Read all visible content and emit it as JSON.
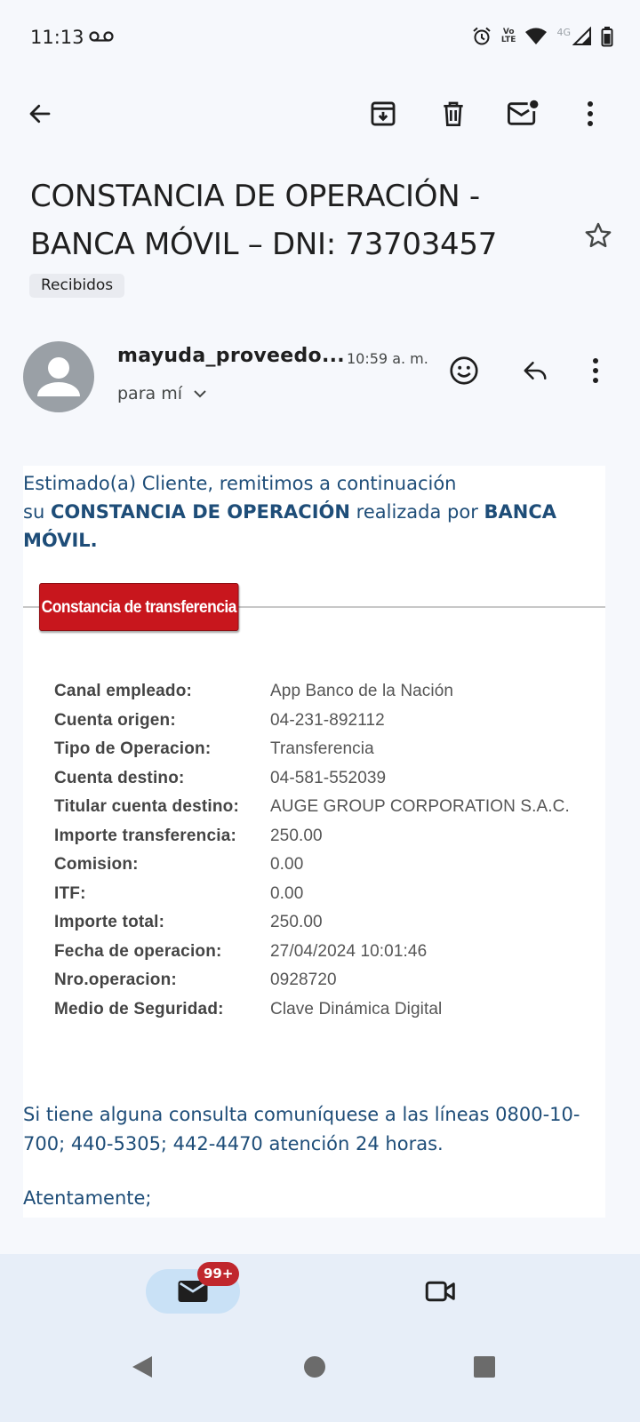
{
  "status_bar": {
    "time": "11:13",
    "volte_label_top": "Vo",
    "volte_label_bottom": "LTE",
    "network_type": "4G"
  },
  "toolbar": {
    "icons": [
      "back-arrow-icon",
      "archive-icon",
      "delete-icon",
      "mark-unread-icon",
      "more-vert-icon"
    ]
  },
  "email": {
    "subject_line1": "CONSTANCIA DE OPERACIÓN -",
    "subject_line2": "BANCA MÓVIL – DNI: 73703457",
    "label": "Recibidos",
    "sender": "mayuda_proveedo...",
    "time": "10:59 a. m.",
    "recipient": "para mí",
    "body": {
      "intro_line1": "Estimado(a) Cliente, remitimos a continuación",
      "intro_line2_pre": "su ",
      "intro_line2_bold1": "CONSTANCIA DE OPERACIÓN",
      "intro_line2_mid": " realizada por ",
      "intro_line2_bold2": "BANCA MÓVIL.",
      "ribbon_label": "Constancia de transferencia",
      "details": [
        {
          "label": "Canal empleado:",
          "value": "App Banco de la Nación"
        },
        {
          "label": "Cuenta origen:",
          "value": "04-231-892112"
        },
        {
          "label": "Tipo de Operacion:",
          "value": "Transferencia"
        },
        {
          "label": "Cuenta destino:",
          "value": "04-581-552039"
        },
        {
          "label": "Titular cuenta destino:",
          "value": "AUGE GROUP CORPORATION S.A.C."
        },
        {
          "label": "Importe transferencia:",
          "value": "250.00"
        },
        {
          "label": "Comision:",
          "value": "0.00"
        },
        {
          "label": "ITF:",
          "value": "0.00"
        },
        {
          "label": "Importe total:",
          "value": "250.00"
        },
        {
          "label": "Fecha de operacion:",
          "value": "27/04/2024 10:01:46"
        },
        {
          "label": "Nro.operacion:",
          "value": "0928720"
        },
        {
          "label": "Medio de Seguridad:",
          "value": "Clave Dinámica Digital"
        }
      ],
      "contact_line1": "Si tiene alguna consulta comuníquese a las líneas 0800-10-",
      "contact_line2": "700; 440-5305; 442-4470 atención 24 horas.",
      "regards": "Atentamente;"
    }
  },
  "bottom_nav": {
    "mail_badge": "99+"
  },
  "colors": {
    "body_text": "#1e4d78",
    "ribbon": "#c8161d",
    "badge": "#c0272d",
    "nav_active": "#c9e1f6"
  }
}
